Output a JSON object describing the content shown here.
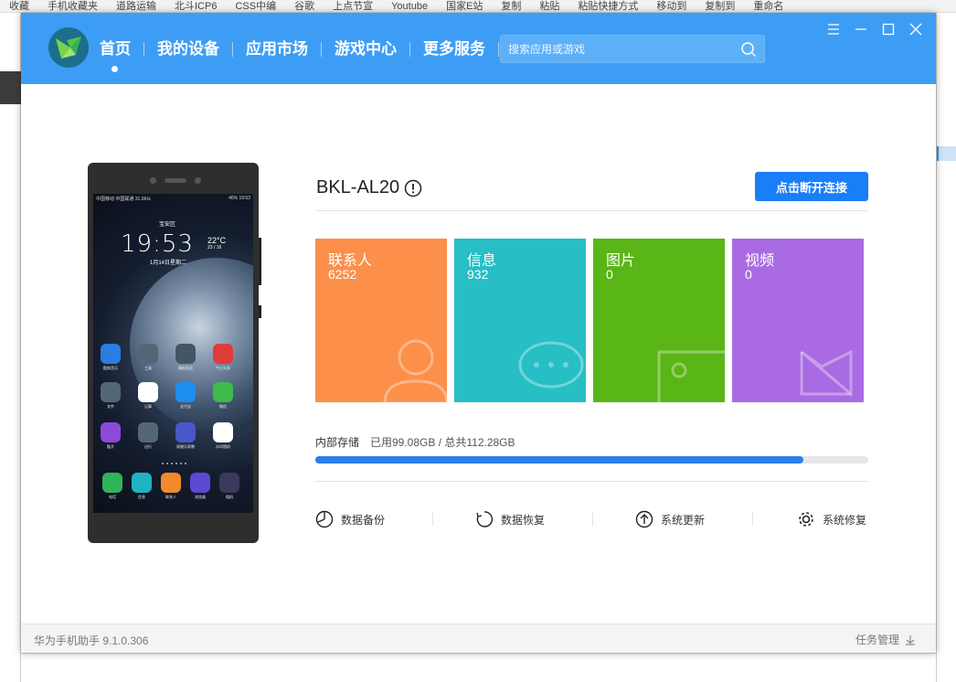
{
  "background": {
    "top_items": [
      "收藏",
      "手机收藏夹",
      "道路运输",
      "北斗ICP6",
      "CSS中编",
      "谷歌",
      "上点节宣",
      "Youtube",
      "国家E站",
      "复制",
      "粘贴",
      "粘贴快捷方式",
      "移动到",
      "复制到",
      "重命名"
    ],
    "left_label": "收藏"
  },
  "header": {
    "nav": [
      {
        "label": "首页",
        "active": true
      },
      {
        "label": "我的设备"
      },
      {
        "label": "应用市场"
      },
      {
        "label": "游戏中心"
      },
      {
        "label": "更多服务"
      }
    ],
    "search_placeholder": "搜索应用或游戏",
    "color": "#3d9df5"
  },
  "phone": {
    "status_left": "中国移动 中国联通 31.6K/s",
    "status_right": "46% 19:53",
    "location": "宝安区",
    "time": "19:53",
    "date": "1月14日星期二",
    "weather_temp": "22°C",
    "weather_range": "23 / 16",
    "apps": [
      {
        "label": "酷狗音乐",
        "color": "#2a7de1"
      },
      {
        "label": "工具",
        "color": "#556677"
      },
      {
        "label": "情报家居",
        "color": "#445566"
      },
      {
        "label": "今日头条",
        "color": "#e03b3b"
      },
      {
        "label": "文件",
        "color": "#556677"
      },
      {
        "label": "记事",
        "color": "#ffffff"
      },
      {
        "label": "支付宝",
        "color": "#1a8ff0"
      },
      {
        "label": "微信",
        "color": "#3dbb4a"
      },
      {
        "label": "酷开",
        "color": "#8d49d9"
      },
      {
        "label": "出行",
        "color": "#556677"
      },
      {
        "label": "易捷乐家教",
        "color": "#4a57c9"
      },
      {
        "label": "水印相机",
        "color": "#ffffff"
      }
    ],
    "dock": [
      {
        "label": "电话",
        "color": "#2fb45a"
      },
      {
        "label": "信息",
        "color": "#1fb3c4"
      },
      {
        "label": "联系人",
        "color": "#f08a2b"
      },
      {
        "label": "浏览器",
        "color": "#5b4ad3"
      },
      {
        "label": "相机",
        "color": "#3a3a5a"
      }
    ]
  },
  "device": {
    "name": "BKL-AL20",
    "disconnect_label": "点击断开连接"
  },
  "tiles": [
    {
      "label": "联系人",
      "count": "6252",
      "color": "#fc8f4a",
      "icon": "person-icon"
    },
    {
      "label": "信息",
      "count": "932",
      "color": "#27bec5",
      "icon": "chat-icon"
    },
    {
      "label": "图片",
      "count": "0",
      "color": "#5ab516",
      "icon": "image-icon"
    },
    {
      "label": "视频",
      "count": "0",
      "color": "#aa6be2",
      "icon": "video-icon"
    }
  ],
  "storage": {
    "label": "内部存储",
    "text": "已用99.08GB / 总共112.28GB",
    "used_fraction": 0.882
  },
  "tools": [
    {
      "label": "数据备份",
      "icon": "backup-icon"
    },
    {
      "label": "数据恢复",
      "icon": "restore-icon"
    },
    {
      "label": "系统更新",
      "icon": "update-icon"
    },
    {
      "label": "系统修复",
      "icon": "repair-icon"
    }
  ],
  "footer": {
    "version": "华为手机助手 9.1.0.306",
    "task_manager": "任务管理"
  }
}
